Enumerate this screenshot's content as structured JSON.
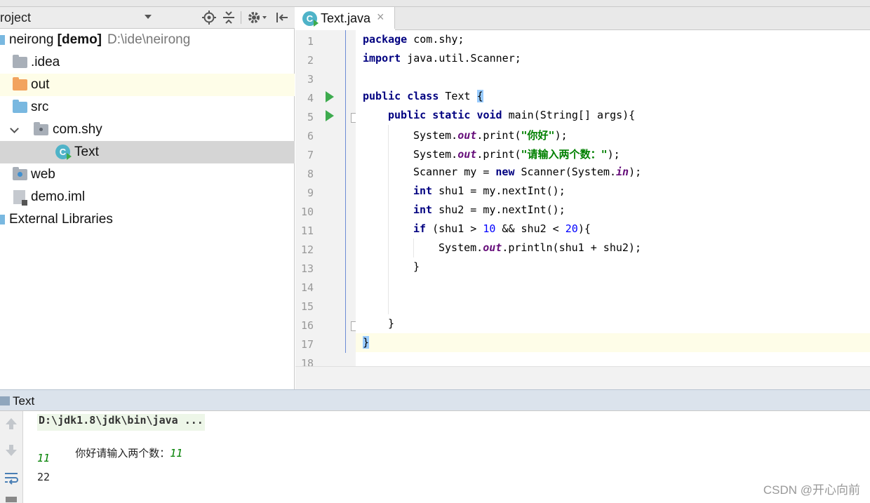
{
  "project_panel": {
    "title": "roject",
    "tree": [
      {
        "name": "neirong [demo]",
        "path": "D:\\ide\\neirong"
      },
      {
        "name": ".idea"
      },
      {
        "name": "out"
      },
      {
        "name": "src"
      },
      {
        "name": "com.shy"
      },
      {
        "name": "Text"
      },
      {
        "name": "web"
      },
      {
        "name": "demo.iml"
      },
      {
        "name": "External Libraries"
      }
    ]
  },
  "editor": {
    "tab": {
      "label": "Text.java",
      "close": "×",
      "icon_letter": "C"
    },
    "line_numbers": [
      "1",
      "2",
      "3",
      "4",
      "5",
      "6",
      "7",
      "8",
      "9",
      "10",
      "11",
      "12",
      "13",
      "14",
      "15",
      "16",
      "17",
      "18"
    ],
    "code": {
      "l1": {
        "kw": "package",
        "rest": " com.shy;"
      },
      "l2": {
        "kw": "import",
        "rest": " java.util.Scanner;"
      },
      "l4": {
        "kw1": "public",
        "kw2": "class",
        "rest": " Text ",
        "brace": "{"
      },
      "l5": {
        "kw1": "public",
        "kw2": "static",
        "kw3": "void",
        "rest": " main(String[] args){"
      },
      "l6": {
        "pre": "System.",
        "fld": "out",
        "mid": ".print(",
        "str": "\"你好\"",
        "post": ");"
      },
      "l7": {
        "pre": "System.",
        "fld": "out",
        "mid": ".print(",
        "str": "\"请输入两个数：\"",
        "post": ");"
      },
      "l8": {
        "pre": "Scanner my = ",
        "kw": "new",
        "mid": " Scanner(System.",
        "fld": "in",
        "post": ");"
      },
      "l9": {
        "kw": "int",
        "rest": " shu1 = my.nextInt();"
      },
      "l10": {
        "kw": "int",
        "rest": " shu2 = my.nextInt();"
      },
      "l11": {
        "kw": "if",
        "a": " (shu1 > ",
        "n1": "10",
        "b": " && shu2 < ",
        "n2": "20",
        "c": "){"
      },
      "l12": {
        "pre": "System.",
        "fld": "out",
        "post": ".println(shu1 + shu2);"
      },
      "l13": "}",
      "l16": "}",
      "l17": "}"
    }
  },
  "run_panel": {
    "title": "Text",
    "console": {
      "command": "D:\\jdk1.8\\jdk\\bin\\java ...",
      "prompt_output": "你好请输入两个数：",
      "input1": "11",
      "input2": "11",
      "result": "22"
    }
  },
  "watermark": "CSDN @开心向前",
  "colors": {
    "keyword": "#000080",
    "string": "#008000",
    "field": "#660e7a",
    "number": "#0000ff",
    "run_green": "#3dab4e"
  }
}
